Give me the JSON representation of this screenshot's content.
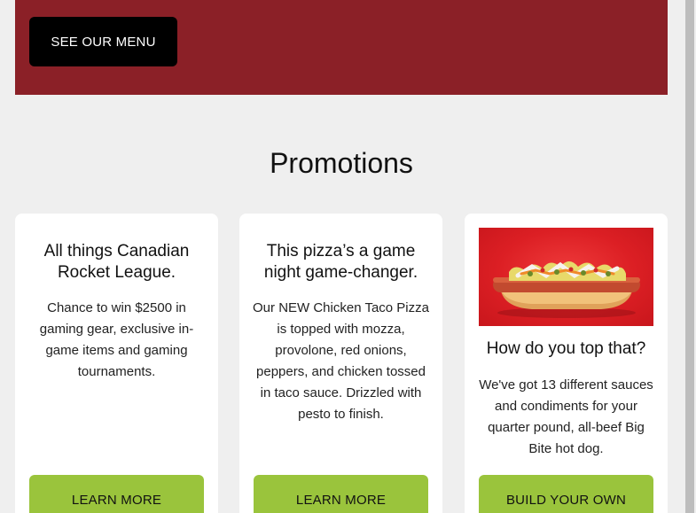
{
  "hero": {
    "menu_button": "SEE OUR MENU",
    "background_color": "#8b2027"
  },
  "promotions": {
    "title": "Promotions",
    "cards": [
      {
        "title": "All things Canadian Rocket League.",
        "body": "Chance to win $2500 in gaming gear, exclusive in-game items and gaming tournaments.",
        "button": "LEARN MORE"
      },
      {
        "title": "This pizza’s a game night game-changer.",
        "body": "Our NEW Chicken Taco Pizza is topped with mozza, provolone, red onions, peppers, and chicken tossed in taco sauce. Drizzled with pesto to finish.",
        "button": "LEARN MORE"
      },
      {
        "image": "hot-dog-photo",
        "title": "How do you top that?",
        "body": "We've got 13 different sauces and condiments for your quarter pound, all-beef Big Bite hot dog.",
        "button": "BUILD YOUR OWN"
      }
    ],
    "button_color": "#9ac43c"
  }
}
